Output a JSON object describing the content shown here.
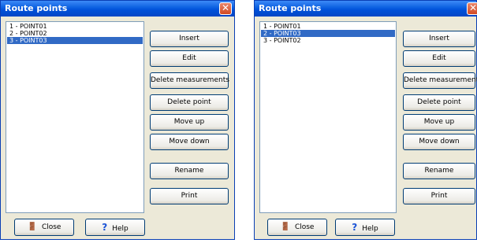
{
  "left": {
    "title": "Route points",
    "close_glyph": "✕",
    "items": [
      "1 - POINT01",
      "2 - POINT02",
      "3 - POINT03"
    ],
    "selected_index": 2,
    "buttons": {
      "insert": "Insert",
      "edit": "Edit",
      "delete_measurements": "Delete measurements",
      "delete_point": "Delete point",
      "move_up": "Move up",
      "move_down": "Move down",
      "rename": "Rename",
      "print": "Print"
    },
    "bottom": {
      "close": "Close",
      "help": "Help"
    }
  },
  "right": {
    "title": "Route points",
    "close_glyph": "✕",
    "items": [
      "1 - POINT01",
      "2 - POINT03",
      "3 - POINT02"
    ],
    "selected_index": 1,
    "buttons": {
      "insert": "Insert",
      "edit": "Edit",
      "delete_measurements": "Delete measurements",
      "delete_point": "Delete point",
      "move_up": "Move up",
      "move_down": "Move down",
      "rename": "Rename",
      "print": "Print"
    },
    "bottom": {
      "close": "Close",
      "help": "Help"
    }
  },
  "icons": {
    "close_button_icon": "door-person-icon",
    "help_button_icon": "question-mark-icon"
  },
  "colors": {
    "titlebar": "#0a5fe0",
    "selection": "#316ac5",
    "dialog_bg": "#ece9d8"
  }
}
